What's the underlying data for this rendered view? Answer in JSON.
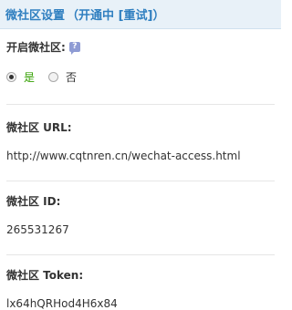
{
  "header": {
    "title": "微社区设置",
    "status_open": "（开通中",
    "reset_label": "[重试]",
    "status_close": "）"
  },
  "enable": {
    "label": "开启微社区:",
    "help_icon": "help-icon",
    "option_yes": "是",
    "option_no": "否",
    "selected": "是"
  },
  "fields": {
    "url_label": "微社区 URL:",
    "url_value": "http://www.cqtnren.cn/wechat-access.html",
    "id_label": "微社区 ID:",
    "id_value": "265531267",
    "token_label": "微社区 Token:",
    "token_value": "lx64hQRHod4H6x84"
  },
  "colors": {
    "header_text": "#2f7fc0",
    "header_bg": "#e8f1f8",
    "yes_text": "#33a000"
  }
}
